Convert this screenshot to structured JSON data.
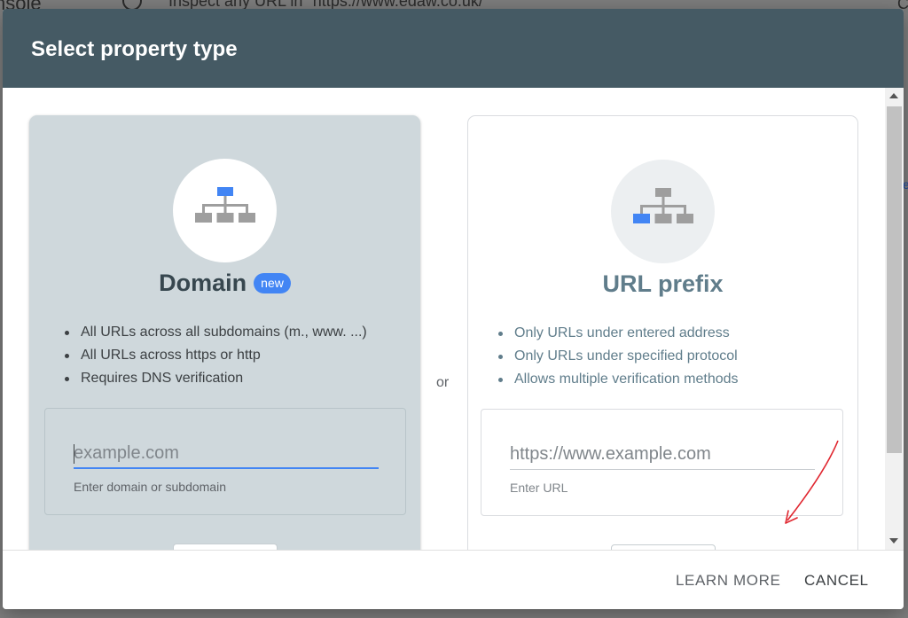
{
  "background": {
    "console_text": "nsole",
    "search_text": "Inspect any URL in \"https://www.edaw.co.uk/\"",
    "right_glyph": "C",
    "right_link": "e"
  },
  "dialog": {
    "title": "Select property type",
    "separator": "or",
    "domain_card": {
      "icon": "sitemap-top-highlight-icon",
      "title": "Domain",
      "badge": "new",
      "features": [
        "All URLs across all subdomains (m., www. ...)",
        "All URLs across https or http",
        "Requires DNS verification"
      ],
      "input_value": "",
      "input_placeholder": "example.com",
      "input_helper": "Enter domain or subdomain",
      "button_label": ""
    },
    "url_card": {
      "icon": "sitemap-bottom-highlight-icon",
      "title": "URL prefix",
      "features": [
        "Only URLs under entered address",
        "Only URLs under specified protocol",
        "Allows multiple verification methods"
      ],
      "input_value": "",
      "input_placeholder": "https://www.example.com",
      "input_helper": "Enter URL",
      "button_label": ""
    },
    "footer": {
      "learn_more": "LEARN MORE",
      "cancel": "CANCEL"
    }
  },
  "colors": {
    "header": "#455a64",
    "accent": "#4285f4",
    "domain_card_bg": "#cfd8dc",
    "annotation_arrow": "#e0262f"
  }
}
